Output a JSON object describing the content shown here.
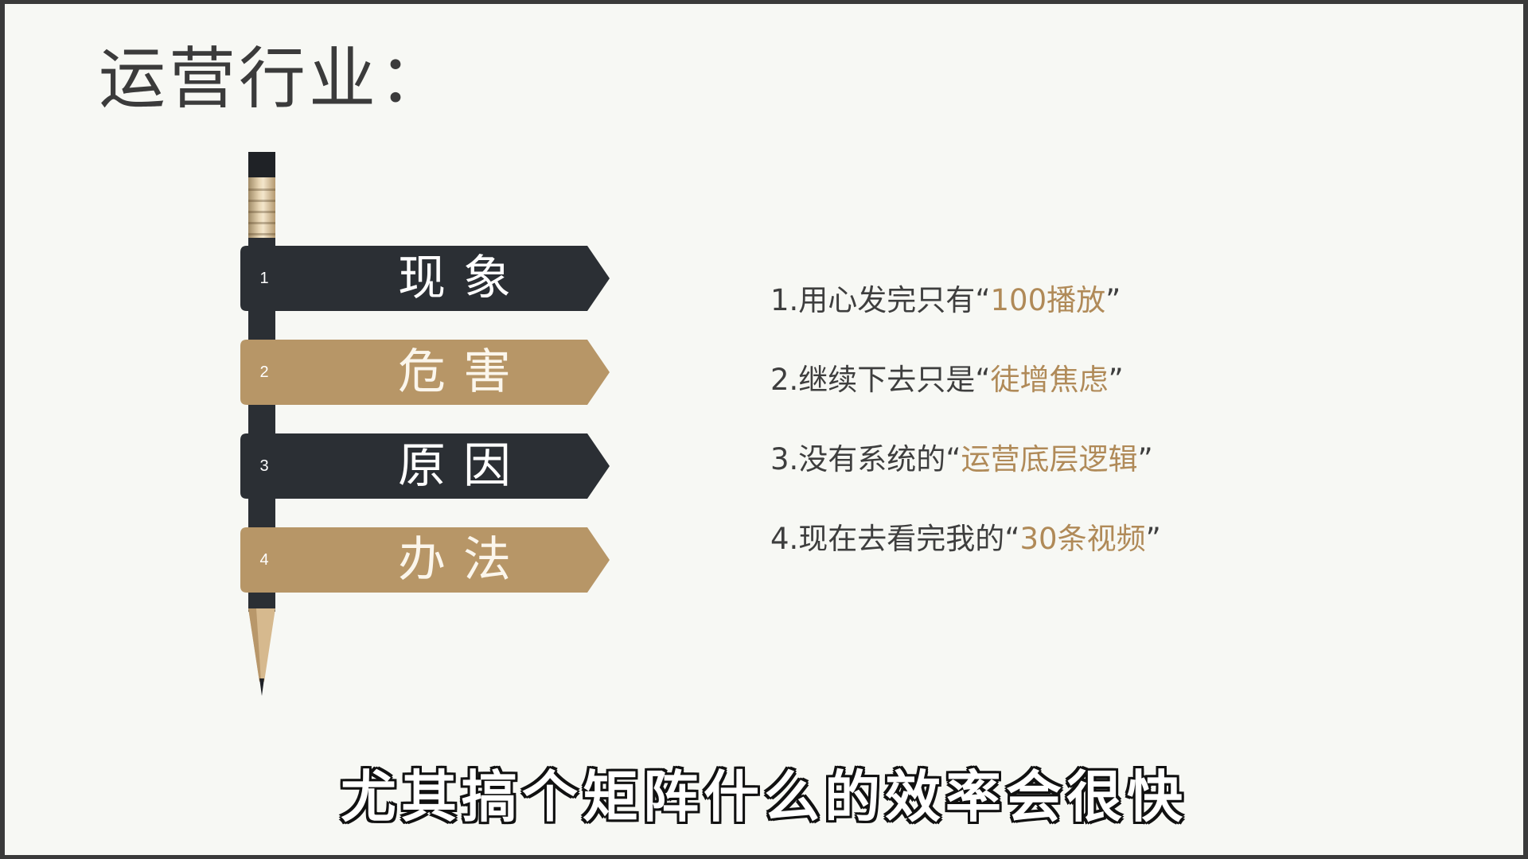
{
  "slide": {
    "title": "运营行业：",
    "steps": [
      {
        "num": "1",
        "label": "现象",
        "style": "dark"
      },
      {
        "num": "2",
        "label": "危害",
        "style": "gold"
      },
      {
        "num": "3",
        "label": "原因",
        "style": "dark"
      },
      {
        "num": "4",
        "label": "办法",
        "style": "gold"
      }
    ],
    "points": [
      {
        "prefix": "1.用心发完只有",
        "highlight": "100播放"
      },
      {
        "prefix": "2.继续下去只是",
        "highlight": "徒增焦虑"
      },
      {
        "prefix": "3.没有系统的",
        "highlight": "运营底层逻辑"
      },
      {
        "prefix": "4.现在去看完我的",
        "highlight": "30条视频"
      }
    ],
    "open_quote": "“",
    "close_quote": "”",
    "subtitle": "尤其搞个矩阵什么的效率会很快"
  },
  "colors": {
    "background": "#f7f8f4",
    "dark_bar": "#2b2f34",
    "gold_bar": "#b79667",
    "highlight_text": "#b08a58",
    "body_text": "#3e3e3e"
  }
}
